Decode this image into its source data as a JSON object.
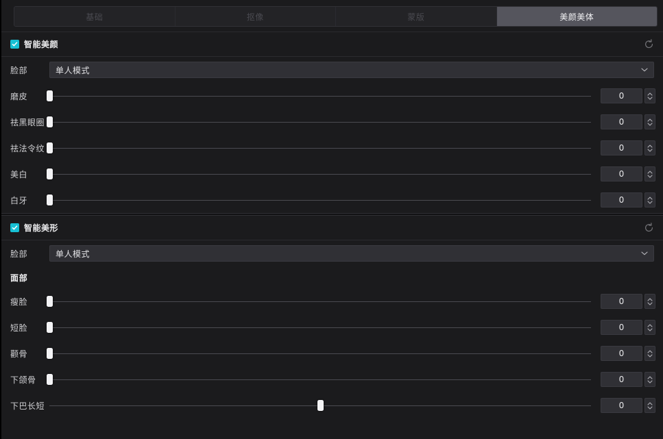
{
  "tabs": [
    {
      "label": "基础",
      "active": false
    },
    {
      "label": "抠像",
      "active": false
    },
    {
      "label": "蒙版",
      "active": false
    },
    {
      "label": "美颜美体",
      "active": true
    }
  ],
  "colors": {
    "accent": "#17c0d4",
    "panel_bg": "#1b1b1d",
    "row_bg": "#202023",
    "control_bg": "#303035",
    "tab_active_bg": "#55555d"
  },
  "sections": [
    {
      "id": "smart-beauty",
      "title": "智能美颜",
      "checked": true,
      "reset_icon": "reset-circular-arrow-icon",
      "select": {
        "label": "脸部",
        "value": "单人模式",
        "caret_icon": "chevron-down-icon"
      },
      "sliders": [
        {
          "label": "磨皮",
          "value": "0",
          "percent": 0
        },
        {
          "label": "祛黑眼圈",
          "value": "0",
          "percent": 0
        },
        {
          "label": "祛法令纹",
          "value": "0",
          "percent": 0
        },
        {
          "label": "美白",
          "value": "0",
          "percent": 0
        },
        {
          "label": "白牙",
          "value": "0",
          "percent": 0
        }
      ]
    },
    {
      "id": "smart-reshape",
      "title": "智能美形",
      "checked": true,
      "reset_icon": "reset-circular-arrow-icon",
      "select": {
        "label": "脸部",
        "value": "单人模式",
        "caret_icon": "chevron-down-icon"
      },
      "subheading": "面部",
      "sliders": [
        {
          "label": "瘦脸",
          "value": "0",
          "percent": 0
        },
        {
          "label": "短脸",
          "value": "0",
          "percent": 0
        },
        {
          "label": "颧骨",
          "value": "0",
          "percent": 0
        },
        {
          "label": "下颌骨",
          "value": "0",
          "percent": 0
        },
        {
          "label": "下巴长短",
          "value": "0",
          "percent": 50
        }
      ]
    }
  ]
}
